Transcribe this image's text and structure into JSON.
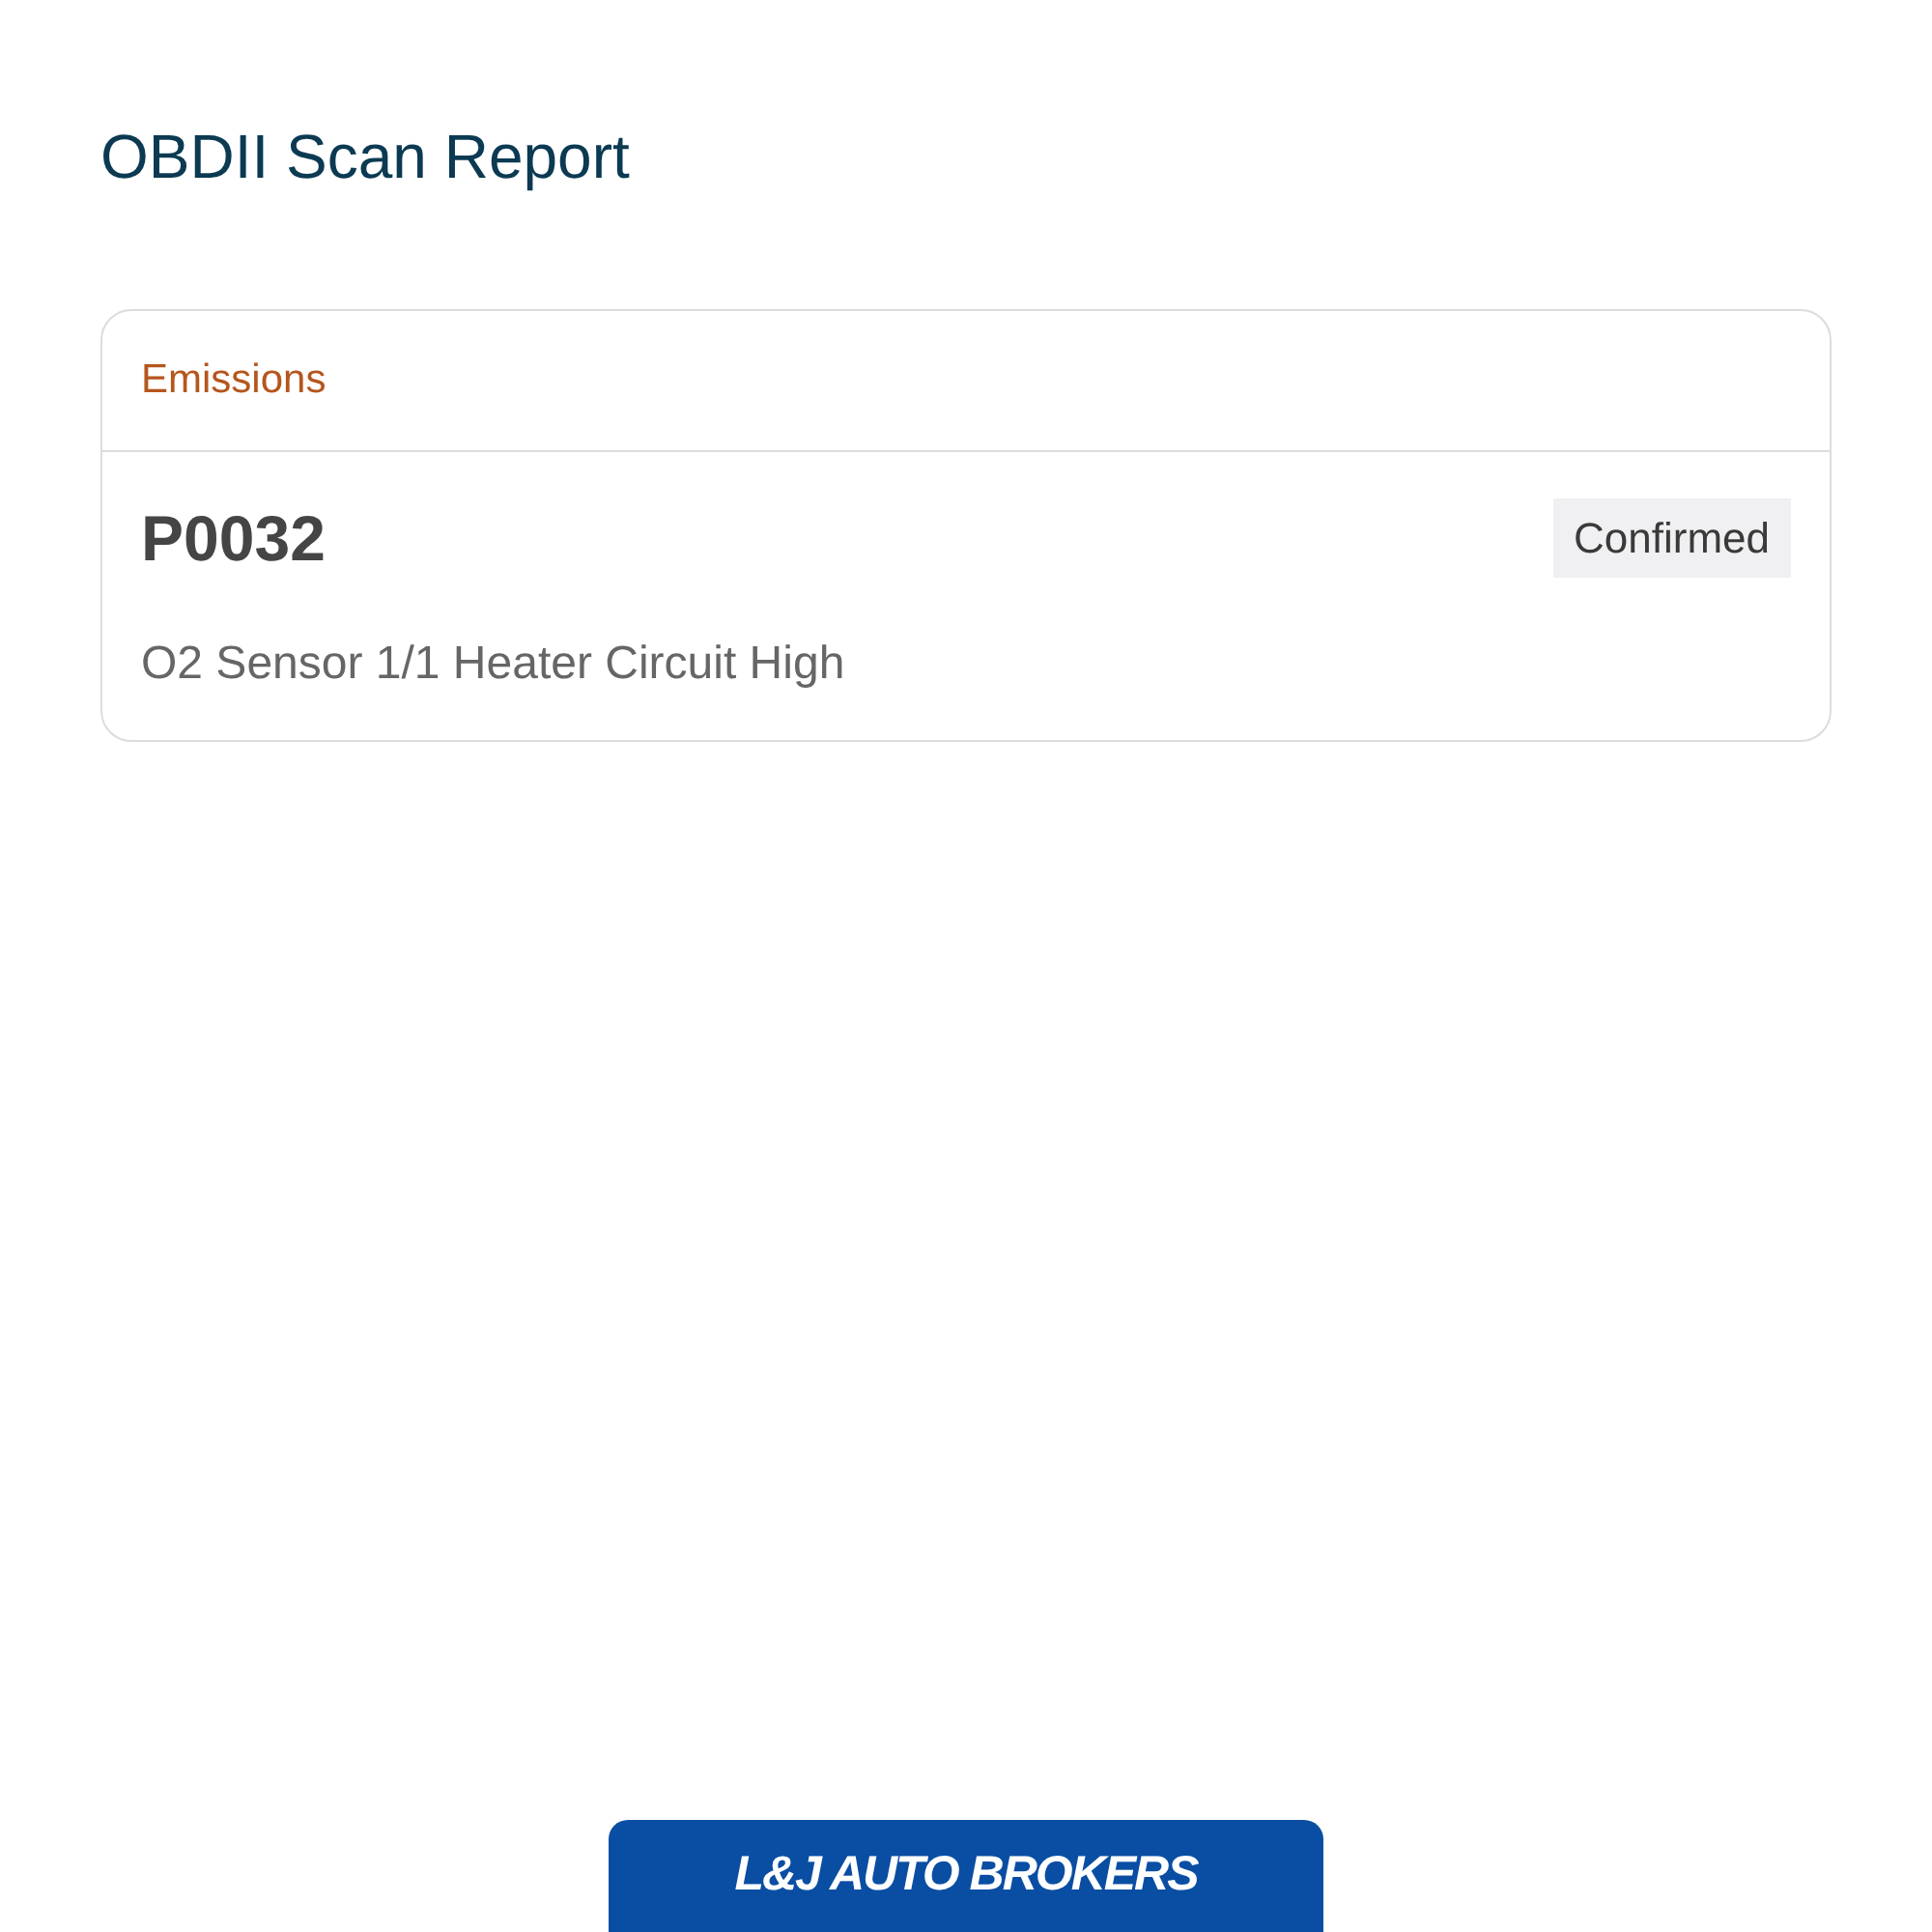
{
  "page": {
    "title": "OBDII Scan Report"
  },
  "sections": [
    {
      "title": "Emissions",
      "codes": [
        {
          "code": "P0032",
          "status": "Confirmed",
          "description": "O2 Sensor 1/1 Heater Circuit High"
        }
      ]
    }
  ],
  "footer": {
    "logo_text": "L&J AUTO BROKERS"
  }
}
